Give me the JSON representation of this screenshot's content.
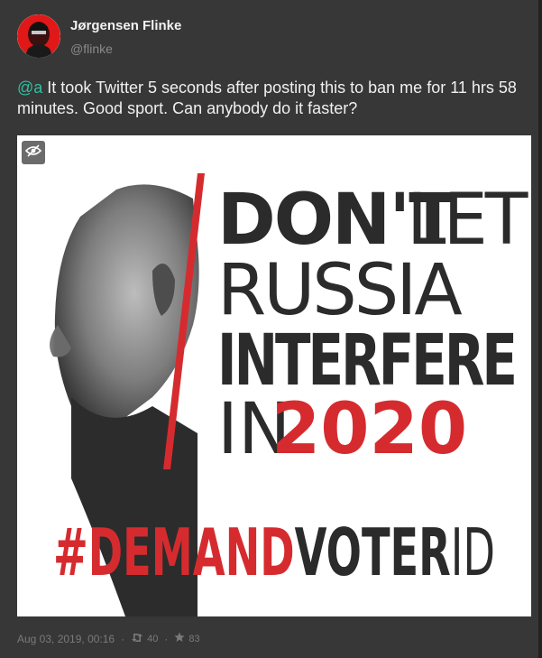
{
  "author": {
    "name": "Jørgensen Flinke",
    "handle": "@flinke"
  },
  "post": {
    "mention": "@a",
    "text": " It took Twitter 5 seconds after posting this to ban me for 11 hrs 58 minutes. Good sport. Can anybody do it faster?"
  },
  "media": {
    "hide_icon": "eye-slash-icon",
    "line1_bold": "DON'T",
    "line1_light": "LET",
    "line2": "RUSSIA",
    "line3": "INTERFERE",
    "line4_light": "IN",
    "line4_red": "2020",
    "hashtag_red": "#DEMAND",
    "hashtag_dark": "VOTER",
    "hashtag_light": "ID"
  },
  "footer": {
    "timestamp": "Aug 03, 2019, 00:16",
    "separator": "·",
    "reblog_icon": "retweet-icon",
    "reblog_count": "40",
    "favourite_icon": "star-icon",
    "favourite_count": "83"
  },
  "colors": {
    "accent": "#2fc1a0",
    "poster_red": "#d52b2f",
    "poster_dark": "#2b2b2b"
  }
}
